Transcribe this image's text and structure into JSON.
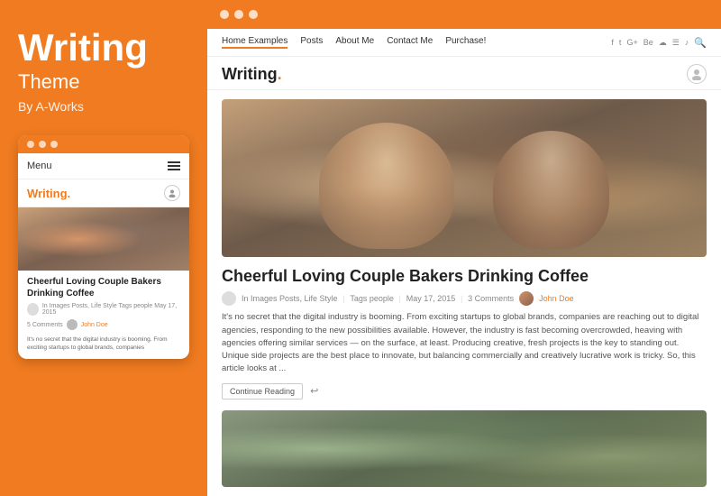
{
  "left": {
    "title": "Writing",
    "subtitle": "Theme",
    "author": "By A-Works",
    "mobile": {
      "menu_label": "Menu",
      "logo": "Writing",
      "logo_dot": ".",
      "article_title": "Cheerful Loving Couple Bakers Drinking Coffee",
      "meta_text": "In Images Posts, Life Style  Tags people   May 17, 2015",
      "comments": "5 Comments",
      "author_name": "John Doe",
      "body_preview": "It's no secret that the digital industry is booming. From exciting startups to global brands, companies"
    }
  },
  "right": {
    "browser_dots": [
      "dot1",
      "dot2",
      "dot3"
    ],
    "nav": {
      "links": [
        {
          "label": "Home Examples",
          "active": true
        },
        {
          "label": "Posts"
        },
        {
          "label": "About Me"
        },
        {
          "label": "Contact Me"
        },
        {
          "label": "Purchase!"
        }
      ],
      "social": [
        "f",
        "t",
        "G+",
        "Be",
        "☁",
        "☰",
        "♪"
      ],
      "search": "🔍"
    },
    "site": {
      "logo": "Writing",
      "logo_dot": "."
    },
    "article": {
      "title": "Cheerful Loving Couple Bakers Drinking Coffee",
      "meta_category": "In Images Posts, Life Style",
      "meta_tags": "Tags people",
      "meta_date": "May 17, 2015",
      "meta_comments": "3 Comments",
      "meta_author": "John Doe",
      "excerpt": "It's no secret that the digital industry is booming. From exciting startups to global brands, companies are reaching out to digital agencies, responding to the new possibilities available. However, the industry is fast becoming overcrowded, heaving with agencies offering similar services — on the surface, at least. Producing creative, fresh projects is the key to standing out. Unique side projects are the best place to innovate, but balancing commercially and creatively lucrative work is tricky. So, this article looks at ...",
      "read_more": "Continue Reading"
    }
  }
}
